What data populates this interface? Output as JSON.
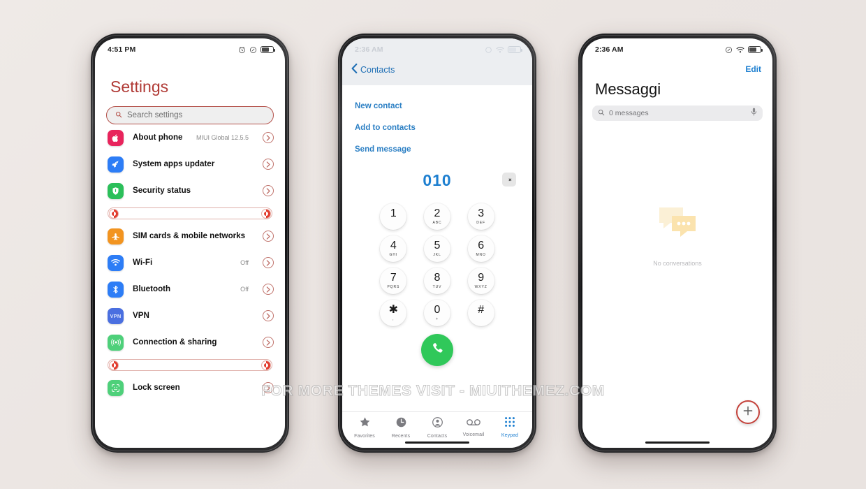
{
  "watermark": "FOR MORE THEMES VISIT - MIUITHEMEZ.COM",
  "theme": {
    "background": "#ece7e3",
    "accent_red": "#b5534c",
    "accent_blue": "#1d7fd0",
    "call_green": "#30c85a"
  },
  "phone1": {
    "status": {
      "time": "4:51 PM",
      "icons": [
        "alarm-icon",
        "silent-icon",
        "battery-icon"
      ]
    },
    "title": "Settings",
    "search": {
      "placeholder": "Search settings",
      "icon": "search-icon"
    },
    "rows": [
      {
        "icon": "apple-icon",
        "color": "#e8245c",
        "label": "About phone",
        "value": "MIUI Global 12.5.5",
        "glyph": ""
      },
      {
        "icon": "rocket-icon",
        "color": "#2d7df6",
        "label": "System apps updater",
        "value": "",
        "glyph": "➤"
      },
      {
        "icon": "shield-icon",
        "color": "#2bbf5a",
        "label": "Security status",
        "value": "",
        "glyph": "⛨"
      },
      {
        "icon": "airplane-icon",
        "color": "#f29420",
        "label": "SIM cards & mobile networks",
        "value": "",
        "glyph": "✈"
      },
      {
        "icon": "wifi-icon",
        "color": "#2d7df6",
        "label": "Wi-Fi",
        "value": "Off",
        "glyph": "▾"
      },
      {
        "icon": "bluetooth-icon",
        "color": "#2d7df6",
        "label": "Bluetooth",
        "value": "Off",
        "glyph": "ᛦ"
      },
      {
        "icon": "vpn-icon",
        "color": "#4a6fe0",
        "label": "VPN",
        "value": "",
        "glyph": "VPN"
      },
      {
        "icon": "broadcast-icon",
        "color": "#4ed07a",
        "label": "Connection & sharing",
        "value": "",
        "glyph": "ʘ"
      },
      {
        "icon": "face-id-icon",
        "color": "#4ed07a",
        "label": "Lock screen",
        "value": "",
        "glyph": "☺"
      }
    ],
    "dividers_after": [
      2,
      7
    ],
    "divider_icon": "yin-yang-icon"
  },
  "phone2": {
    "status": {
      "time": "2:36 AM",
      "icons": [
        "rotate-icon",
        "wifi-icon",
        "battery-icon"
      ]
    },
    "back_label": "Contacts",
    "actions": [
      "New contact",
      "Add to contacts",
      "Send message"
    ],
    "number": "010",
    "delete_icon": "backspace-icon",
    "keys": [
      {
        "n": "1",
        "s": " "
      },
      {
        "n": "2",
        "s": "ABC"
      },
      {
        "n": "3",
        "s": "DEF"
      },
      {
        "n": "4",
        "s": "GHI"
      },
      {
        "n": "5",
        "s": "JKL"
      },
      {
        "n": "6",
        "s": "MNO"
      },
      {
        "n": "7",
        "s": "PQRS"
      },
      {
        "n": "8",
        "s": "TUV"
      },
      {
        "n": "9",
        "s": "WXYZ"
      },
      {
        "n": "✱",
        "s": ","
      },
      {
        "n": "0",
        "s": "+"
      },
      {
        "n": "#",
        "s": ""
      }
    ],
    "call_icon": "phone-handset-icon",
    "tabs": [
      {
        "label": "Favorites",
        "icon": "star-icon",
        "active": false
      },
      {
        "label": "Recents",
        "icon": "clock-icon",
        "active": false
      },
      {
        "label": "Contacts",
        "icon": "person-icon",
        "active": false
      },
      {
        "label": "Voicemail",
        "icon": "voicemail-icon",
        "active": false
      },
      {
        "label": "Keypad",
        "icon": "keypad-icon",
        "active": true
      }
    ]
  },
  "phone3": {
    "status": {
      "time": "2:36 AM",
      "icons": [
        "silent-icon",
        "wifi-icon",
        "battery-icon"
      ]
    },
    "edit_label": "Edit",
    "title": "Messaggi",
    "search": {
      "placeholder": "0 messages",
      "icon": "search-icon",
      "mic": "microphone-icon"
    },
    "empty_text": "No conversations",
    "empty_icon": "chat-bubbles-icon",
    "fab_icon": "plus-icon"
  }
}
